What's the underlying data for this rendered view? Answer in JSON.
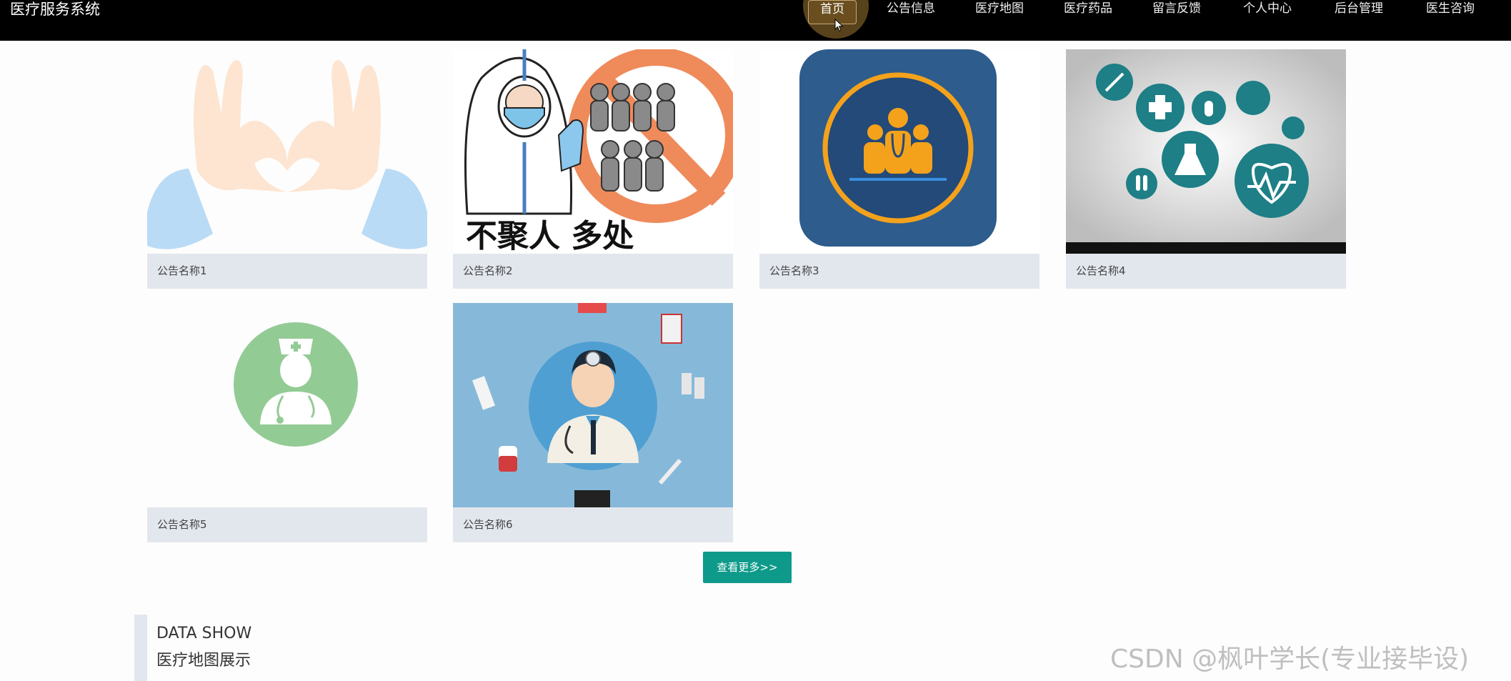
{
  "header": {
    "brand": "医疗服务系统",
    "nav": [
      {
        "label": "首页",
        "active": true
      },
      {
        "label": "公告信息"
      },
      {
        "label": "医疗地图"
      },
      {
        "label": "医疗药品"
      },
      {
        "label": "留言反馈"
      },
      {
        "label": "个人中心"
      },
      {
        "label": "后台管理"
      },
      {
        "label": "医生咨询"
      }
    ]
  },
  "cards": [
    {
      "title": "公告名称1",
      "image": "heart-hands-image"
    },
    {
      "title": "公告名称2",
      "image": "no-gathering-image",
      "image_text": "不聚人 多处"
    },
    {
      "title": "公告名称3",
      "image": "medical-team-icon"
    },
    {
      "title": "公告名称4",
      "image": "medical-icons-image"
    },
    {
      "title": "公告名称5",
      "image": "nurse-avatar-icon"
    },
    {
      "title": "公告名称6",
      "image": "doctor-illustration-image"
    }
  ],
  "more_button": "查看更多>>",
  "section": {
    "en": "DATA SHOW",
    "cn": "医疗地图展示"
  },
  "watermark": "CSDN @枫叶学长(专业接毕设)",
  "colors": {
    "accent": "#0e9a8a",
    "caption_bg": "#e2e6ed",
    "header_bg": "#000000"
  }
}
